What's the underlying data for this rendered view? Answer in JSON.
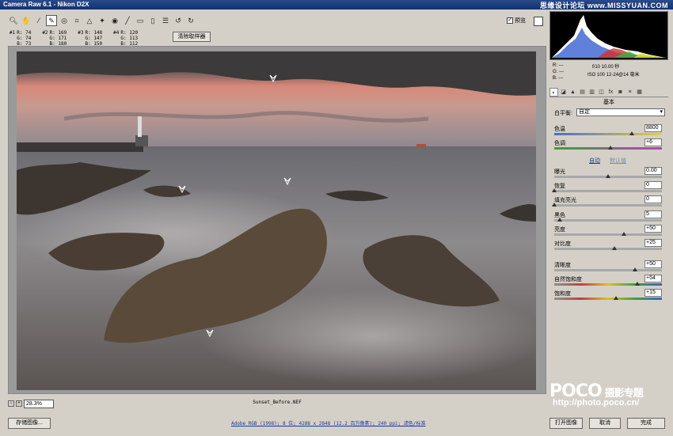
{
  "window": {
    "title": "Camera Raw 6.1 - Nikon D2X"
  },
  "watermark_top": "思缘设计论坛 www.MISSYUAN.COM",
  "toolbar": {
    "tools": [
      {
        "icon": "zoom-icon"
      },
      {
        "icon": "hand-icon"
      },
      {
        "icon": "white-balance-icon"
      },
      {
        "icon": "color-sampler-icon"
      },
      {
        "icon": "targeted-adjust-icon"
      },
      {
        "icon": "crop-icon"
      },
      {
        "icon": "straighten-icon"
      },
      {
        "icon": "spot-removal-icon"
      },
      {
        "icon": "red-eye-icon"
      },
      {
        "icon": "adjustment-brush-icon"
      },
      {
        "icon": "graduated-filter-icon"
      },
      {
        "icon": "trash-icon"
      },
      {
        "icon": "preferences-icon"
      },
      {
        "icon": "rotate-ccw-icon"
      },
      {
        "icon": "rotate-cw-icon"
      }
    ]
  },
  "samplers": [
    {
      "id": "#1",
      "r": "74",
      "g": "74",
      "b": "73"
    },
    {
      "id": "#2",
      "r": "169",
      "g": "171",
      "b": "180"
    },
    {
      "id": "#3",
      "r": "148",
      "g": "147",
      "b": "150"
    },
    {
      "id": "#4",
      "r": "120",
      "g": "113",
      "b": "112"
    }
  ],
  "clear_samplers_label": "清除取样器",
  "preview_label": "预览",
  "image": {
    "filename": "Sunset_Before.NEF",
    "zoom": "28.3%"
  },
  "histogram": {
    "readout": {
      "r": "R: ---",
      "g": "G: ---",
      "b": "B: ---",
      "aperture_shutter": "f/10  10.00 秒",
      "iso_lens": "ISO 100   12-24@14 毫米"
    }
  },
  "panel": {
    "title": "基本",
    "white_balance_label": "白平衡:",
    "white_balance_value": "自定",
    "auto_label": "自动",
    "default_label": "默认值",
    "sliders": [
      {
        "label": "色温",
        "value": "8800",
        "pos": 0.72,
        "grad": "linear-gradient(90deg,#4a6cc8,#e8d040)"
      },
      {
        "label": "色调",
        "value": "+6",
        "pos": 0.52,
        "grad": "linear-gradient(90deg,#3aa040,#c040b0)"
      },
      {
        "label": "曝光",
        "value": "0.00",
        "pos": 0.5,
        "grad": "#a8a8a8"
      },
      {
        "label": "恢复",
        "value": "0",
        "pos": 0.0,
        "grad": "#a8a8a8"
      },
      {
        "label": "填充亮光",
        "value": "0",
        "pos": 0.0,
        "grad": "#a8a8a8"
      },
      {
        "label": "黑色",
        "value": "5",
        "pos": 0.05,
        "grad": "#a8a8a8"
      },
      {
        "label": "亮度",
        "value": "+50",
        "pos": 0.65,
        "grad": "#a8a8a8"
      },
      {
        "label": "对比度",
        "value": "+25",
        "pos": 0.56,
        "grad": "#a8a8a8"
      },
      {
        "label": "清晰度",
        "value": "+50",
        "pos": 0.75,
        "grad": "#a8a8a8"
      },
      {
        "label": "自然饱和度",
        "value": "+54",
        "pos": 0.77,
        "grad": "linear-gradient(90deg,#909090,#c04040,#e0c020,#40a040,#4060c0)"
      },
      {
        "label": "饱和度",
        "value": "+15",
        "pos": 0.57,
        "grad": "linear-gradient(90deg,#909090,#c04040,#e0c020,#40a040,#4060c0)"
      }
    ]
  },
  "bottom": {
    "save_label": "存储图像...",
    "workflow": "Adobe RGB (1998); 8 位; 4288 x 2848 (12.2 百万像素); 240 ppi; 滤色/标准",
    "open_label": "打开图像",
    "cancel_label": "取消",
    "done_label": "完成"
  },
  "branding": {
    "logo": "POCO",
    "title": "摄影专题",
    "url": "http://photo.poco.cn/"
  },
  "colors": {
    "accent": "#1a3a9a",
    "window_bg": "#d4d0c8"
  }
}
